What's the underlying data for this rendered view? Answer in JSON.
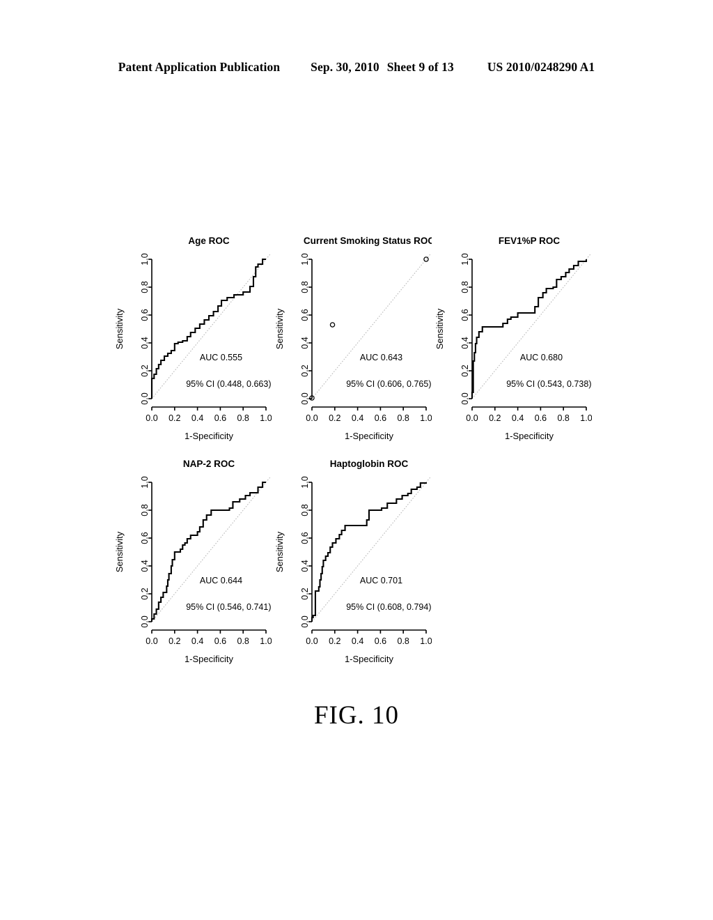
{
  "header": {
    "publication": "Patent Application Publication",
    "date": "Sep. 30, 2010",
    "sheet": "Sheet 9 of 13",
    "number": "US 2010/0248290 A1"
  },
  "figure": {
    "caption": "FIG. 10"
  },
  "axes": {
    "x_label": "1-Specificity",
    "y_label": "Sensitivity",
    "tick_labels": [
      "0.0",
      "0.2",
      "0.4",
      "0.6",
      "0.8",
      "1.0"
    ],
    "tick_values": [
      0.0,
      0.2,
      0.4,
      0.6,
      0.8,
      1.0
    ],
    "xlim": [
      0,
      1
    ],
    "ylim": [
      0,
      1
    ]
  },
  "chart_data": [
    {
      "id": "age",
      "type": "line",
      "title": "Age ROC",
      "xlabel": "1-Specificity",
      "ylabel": "Sensitivity",
      "xlim": [
        0,
        1
      ],
      "ylim": [
        0,
        1
      ],
      "grid": false,
      "legend": "none",
      "auc_label": "AUC 0.555",
      "ci_label": "95% CI (0.448, 0.663)",
      "auc": 0.555,
      "ci_low": 0.448,
      "ci_high": 0.663,
      "reference_line": true,
      "style": "step",
      "points": [
        [
          0.0,
          0.0
        ],
        [
          0.0,
          0.145
        ],
        [
          0.02,
          0.145
        ],
        [
          0.02,
          0.175
        ],
        [
          0.04,
          0.175
        ],
        [
          0.04,
          0.215
        ],
        [
          0.06,
          0.215
        ],
        [
          0.06,
          0.245
        ],
        [
          0.08,
          0.245
        ],
        [
          0.08,
          0.275
        ],
        [
          0.11,
          0.275
        ],
        [
          0.11,
          0.305
        ],
        [
          0.14,
          0.305
        ],
        [
          0.14,
          0.325
        ],
        [
          0.17,
          0.325
        ],
        [
          0.17,
          0.345
        ],
        [
          0.2,
          0.345
        ],
        [
          0.2,
          0.395
        ],
        [
          0.23,
          0.395
        ],
        [
          0.23,
          0.405
        ],
        [
          0.27,
          0.405
        ],
        [
          0.27,
          0.415
        ],
        [
          0.31,
          0.415
        ],
        [
          0.31,
          0.445
        ],
        [
          0.34,
          0.445
        ],
        [
          0.34,
          0.475
        ],
        [
          0.38,
          0.475
        ],
        [
          0.38,
          0.505
        ],
        [
          0.42,
          0.505
        ],
        [
          0.42,
          0.535
        ],
        [
          0.46,
          0.535
        ],
        [
          0.46,
          0.565
        ],
        [
          0.5,
          0.565
        ],
        [
          0.5,
          0.595
        ],
        [
          0.54,
          0.595
        ],
        [
          0.54,
          0.625
        ],
        [
          0.58,
          0.625
        ],
        [
          0.58,
          0.665
        ],
        [
          0.61,
          0.665
        ],
        [
          0.61,
          0.705
        ],
        [
          0.66,
          0.705
        ],
        [
          0.66,
          0.725
        ],
        [
          0.72,
          0.725
        ],
        [
          0.72,
          0.745
        ],
        [
          0.8,
          0.745
        ],
        [
          0.8,
          0.765
        ],
        [
          0.86,
          0.765
        ],
        [
          0.86,
          0.805
        ],
        [
          0.89,
          0.805
        ],
        [
          0.89,
          0.875
        ],
        [
          0.91,
          0.875
        ],
        [
          0.91,
          0.945
        ],
        [
          0.93,
          0.945
        ],
        [
          0.93,
          0.965
        ],
        [
          0.97,
          0.965
        ],
        [
          0.97,
          1.0
        ],
        [
          1.0,
          1.0
        ]
      ],
      "markers": []
    },
    {
      "id": "current-smoking-status",
      "type": "scatter",
      "title": "Current Smoking Status ROC",
      "xlabel": "1-Specificity",
      "ylabel": "Sensitivity",
      "xlim": [
        0,
        1
      ],
      "ylim": [
        0,
        1
      ],
      "grid": false,
      "legend": "none",
      "auc_label": "AUC 0.643",
      "ci_label": "95% CI (0.606, 0.765)",
      "auc": 0.643,
      "ci_low": 0.606,
      "ci_high": 0.765,
      "reference_line": true,
      "style": "points",
      "points": [],
      "markers": [
        [
          0.0,
          0.005
        ],
        [
          0.18,
          0.53
        ],
        [
          1.0,
          1.0
        ]
      ]
    },
    {
      "id": "fev1pp",
      "type": "line",
      "title": "FEV1%P ROC",
      "xlabel": "1-Specificity",
      "ylabel": "Sensitivity",
      "xlim": [
        0,
        1
      ],
      "ylim": [
        0,
        1
      ],
      "grid": false,
      "legend": "none",
      "auc_label": "AUC 0.680",
      "ci_label": "95% CI (0.543, 0.738)",
      "auc": 0.68,
      "ci_low": 0.543,
      "ci_high": 0.738,
      "reference_line": true,
      "style": "step",
      "points": [
        [
          0.0,
          0.0
        ],
        [
          0.0,
          0.045
        ],
        [
          0.01,
          0.045
        ],
        [
          0.01,
          0.27
        ],
        [
          0.02,
          0.27
        ],
        [
          0.02,
          0.33
        ],
        [
          0.03,
          0.33
        ],
        [
          0.03,
          0.395
        ],
        [
          0.04,
          0.395
        ],
        [
          0.04,
          0.44
        ],
        [
          0.06,
          0.44
        ],
        [
          0.06,
          0.48
        ],
        [
          0.09,
          0.48
        ],
        [
          0.09,
          0.515
        ],
        [
          0.27,
          0.515
        ],
        [
          0.27,
          0.54
        ],
        [
          0.31,
          0.54
        ],
        [
          0.31,
          0.57
        ],
        [
          0.34,
          0.57
        ],
        [
          0.34,
          0.585
        ],
        [
          0.4,
          0.585
        ],
        [
          0.4,
          0.615
        ],
        [
          0.55,
          0.615
        ],
        [
          0.55,
          0.66
        ],
        [
          0.58,
          0.66
        ],
        [
          0.58,
          0.725
        ],
        [
          0.62,
          0.725
        ],
        [
          0.62,
          0.76
        ],
        [
          0.65,
          0.76
        ],
        [
          0.65,
          0.79
        ],
        [
          0.71,
          0.79
        ],
        [
          0.71,
          0.8
        ],
        [
          0.74,
          0.8
        ],
        [
          0.74,
          0.855
        ],
        [
          0.78,
          0.855
        ],
        [
          0.78,
          0.875
        ],
        [
          0.82,
          0.875
        ],
        [
          0.82,
          0.905
        ],
        [
          0.85,
          0.905
        ],
        [
          0.85,
          0.93
        ],
        [
          0.89,
          0.93
        ],
        [
          0.89,
          0.955
        ],
        [
          0.93,
          0.955
        ],
        [
          0.93,
          0.985
        ],
        [
          1.0,
          0.985
        ],
        [
          1.0,
          1.0
        ]
      ],
      "markers": []
    },
    {
      "id": "nap-2",
      "type": "line",
      "title": "NAP-2 ROC",
      "xlabel": "1-Specificity",
      "ylabel": "Sensitivity",
      "xlim": [
        0,
        1
      ],
      "ylim": [
        0,
        1
      ],
      "grid": false,
      "legend": "none",
      "auc_label": "AUC 0.644",
      "ci_label": "95% CI (0.546,  0.741)",
      "auc": 0.644,
      "ci_low": 0.546,
      "ci_high": 0.741,
      "reference_line": true,
      "style": "step",
      "points": [
        [
          0.0,
          0.0
        ],
        [
          0.0,
          0.02
        ],
        [
          0.02,
          0.02
        ],
        [
          0.02,
          0.055
        ],
        [
          0.04,
          0.055
        ],
        [
          0.04,
          0.09
        ],
        [
          0.06,
          0.09
        ],
        [
          0.06,
          0.14
        ],
        [
          0.08,
          0.14
        ],
        [
          0.08,
          0.175
        ],
        [
          0.1,
          0.175
        ],
        [
          0.1,
          0.21
        ],
        [
          0.13,
          0.21
        ],
        [
          0.13,
          0.255
        ],
        [
          0.14,
          0.255
        ],
        [
          0.14,
          0.3
        ],
        [
          0.15,
          0.3
        ],
        [
          0.15,
          0.345
        ],
        [
          0.17,
          0.345
        ],
        [
          0.17,
          0.4
        ],
        [
          0.18,
          0.4
        ],
        [
          0.18,
          0.445
        ],
        [
          0.2,
          0.445
        ],
        [
          0.2,
          0.5
        ],
        [
          0.25,
          0.5
        ],
        [
          0.25,
          0.52
        ],
        [
          0.27,
          0.52
        ],
        [
          0.27,
          0.55
        ],
        [
          0.29,
          0.55
        ],
        [
          0.29,
          0.565
        ],
        [
          0.31,
          0.565
        ],
        [
          0.31,
          0.595
        ],
        [
          0.34,
          0.595
        ],
        [
          0.34,
          0.62
        ],
        [
          0.4,
          0.62
        ],
        [
          0.4,
          0.645
        ],
        [
          0.42,
          0.645
        ],
        [
          0.42,
          0.68
        ],
        [
          0.45,
          0.68
        ],
        [
          0.45,
          0.73
        ],
        [
          0.48,
          0.73
        ],
        [
          0.48,
          0.765
        ],
        [
          0.52,
          0.765
        ],
        [
          0.52,
          0.8
        ],
        [
          0.68,
          0.8
        ],
        [
          0.68,
          0.815
        ],
        [
          0.71,
          0.815
        ],
        [
          0.71,
          0.86
        ],
        [
          0.77,
          0.86
        ],
        [
          0.77,
          0.88
        ],
        [
          0.82,
          0.88
        ],
        [
          0.82,
          0.905
        ],
        [
          0.86,
          0.905
        ],
        [
          0.86,
          0.925
        ],
        [
          0.93,
          0.925
        ],
        [
          0.93,
          0.965
        ],
        [
          0.97,
          0.965
        ],
        [
          0.97,
          1.0
        ],
        [
          1.0,
          1.0
        ]
      ],
      "markers": []
    },
    {
      "id": "haptoglobin",
      "type": "line",
      "title": "Haptoglobin ROC",
      "xlabel": "1-Specificity",
      "ylabel": "Sensitivity",
      "xlim": [
        0,
        1
      ],
      "ylim": [
        0,
        1
      ],
      "grid": false,
      "legend": "none",
      "auc_label": "AUC 0.701",
      "ci_label": "95% CI (0.608,  0.794)",
      "auc": 0.701,
      "ci_low": 0.608,
      "ci_high": 0.794,
      "reference_line": true,
      "style": "step",
      "points": [
        [
          0.0,
          0.0
        ],
        [
          0.0,
          0.03
        ],
        [
          0.01,
          0.03
        ],
        [
          0.01,
          0.045
        ],
        [
          0.03,
          0.045
        ],
        [
          0.03,
          0.22
        ],
        [
          0.06,
          0.22
        ],
        [
          0.06,
          0.25
        ],
        [
          0.07,
          0.25
        ],
        [
          0.07,
          0.3
        ],
        [
          0.08,
          0.3
        ],
        [
          0.08,
          0.345
        ],
        [
          0.09,
          0.345
        ],
        [
          0.09,
          0.395
        ],
        [
          0.1,
          0.395
        ],
        [
          0.1,
          0.44
        ],
        [
          0.12,
          0.44
        ],
        [
          0.12,
          0.47
        ],
        [
          0.14,
          0.47
        ],
        [
          0.14,
          0.495
        ],
        [
          0.16,
          0.495
        ],
        [
          0.16,
          0.535
        ],
        [
          0.18,
          0.535
        ],
        [
          0.18,
          0.565
        ],
        [
          0.21,
          0.565
        ],
        [
          0.21,
          0.595
        ],
        [
          0.24,
          0.595
        ],
        [
          0.24,
          0.625
        ],
        [
          0.26,
          0.625
        ],
        [
          0.26,
          0.655
        ],
        [
          0.29,
          0.655
        ],
        [
          0.29,
          0.69
        ],
        [
          0.48,
          0.69
        ],
        [
          0.48,
          0.73
        ],
        [
          0.5,
          0.73
        ],
        [
          0.5,
          0.8
        ],
        [
          0.61,
          0.8
        ],
        [
          0.61,
          0.815
        ],
        [
          0.66,
          0.815
        ],
        [
          0.66,
          0.85
        ],
        [
          0.74,
          0.85
        ],
        [
          0.74,
          0.88
        ],
        [
          0.79,
          0.88
        ],
        [
          0.79,
          0.905
        ],
        [
          0.84,
          0.905
        ],
        [
          0.84,
          0.92
        ],
        [
          0.87,
          0.92
        ],
        [
          0.87,
          0.95
        ],
        [
          0.92,
          0.95
        ],
        [
          0.92,
          0.965
        ],
        [
          0.95,
          0.965
        ],
        [
          0.95,
          0.995
        ],
        [
          1.0,
          0.995
        ],
        [
          1.0,
          1.0
        ]
      ],
      "markers": []
    }
  ]
}
